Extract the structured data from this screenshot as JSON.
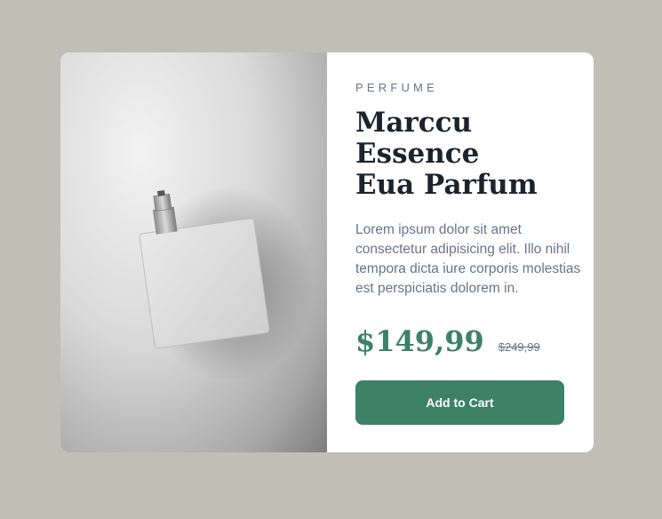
{
  "product": {
    "category": "PERFUME",
    "title_lines": [
      "Marccu",
      "Essence",
      "Eua Parfum"
    ],
    "description": "Lorem ipsum dolor sit amet consectetur adipisicing elit. Illo nihil tempora dicta iure corporis molestias est perspiciatis dolorem in.",
    "price": "$149,99",
    "old_price": "$249,99",
    "cta_label": "Add to Cart"
  },
  "colors": {
    "page_background": "#bfbfb6",
    "card_background": "#ffffff",
    "accent": "#3d8168",
    "heading": "#1c232b",
    "body_text": "#6c7289"
  },
  "icons": {
    "cart": "cart-icon"
  }
}
